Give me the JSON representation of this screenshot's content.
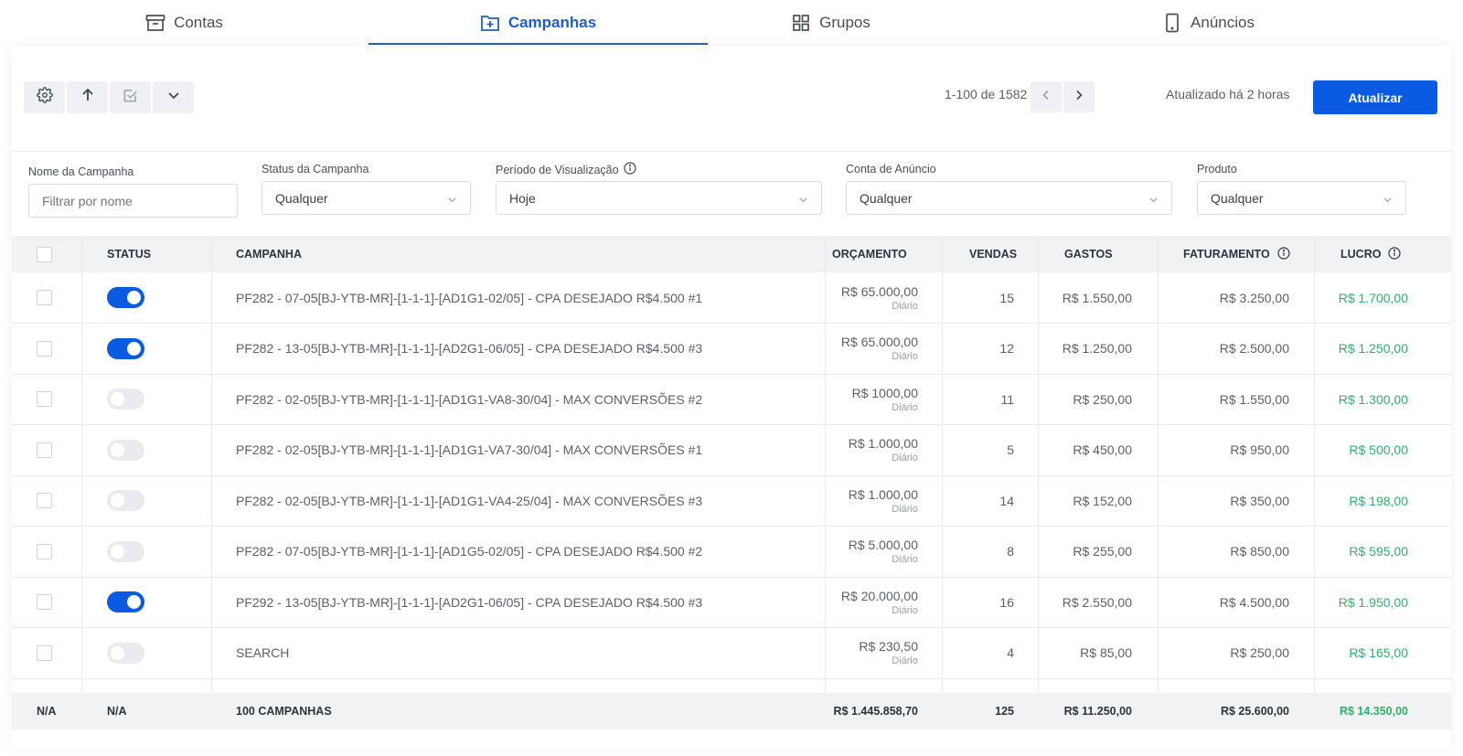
{
  "nav": {
    "tabs": [
      {
        "label": "Contas",
        "icon": "archive-icon"
      },
      {
        "label": "Campanhas",
        "icon": "folder-plus-icon",
        "active": true
      },
      {
        "label": "Grupos",
        "icon": "grid-icon"
      },
      {
        "label": "Anúncios",
        "icon": "smartphone-icon"
      }
    ]
  },
  "toolbar": {
    "pagination": "1-100 de 1582",
    "updated": "Atualizado há 2 horas",
    "refresh_label": "Atualizar"
  },
  "filters": {
    "name": {
      "label": "Nome da Campanha",
      "placeholder": "Filtrar por nome"
    },
    "status": {
      "label": "Status da Campanha",
      "value": "Qualquer"
    },
    "period": {
      "label": "Período de Visualização",
      "value": "Hoje"
    },
    "account": {
      "label": "Conta de Anúncio",
      "value": "Qualquer"
    },
    "product": {
      "label": "Produto",
      "value": "Qualquer"
    }
  },
  "table": {
    "headers": {
      "status": "STATUS",
      "campaign": "CAMPANHA",
      "budget": "ORÇAMENTO",
      "sales": "VENDAS",
      "spend": "GASTOS",
      "revenue": "FATURAMENTO",
      "profit": "LUCRO"
    },
    "rows": [
      {
        "active": true,
        "name": "PF282 - 07-05[BJ-YTB-MR]-[1-1-1]-[AD1G1-02/05] - CPA DESEJADO R$4.500 #1",
        "budget": "R$ 65.000,00",
        "period": "Diário",
        "sales": "15",
        "spend": "R$ 1.550,00",
        "revenue": "R$ 3.250,00",
        "profit": "R$ 1.700,00"
      },
      {
        "active": true,
        "name": "PF282 - 13-05[BJ-YTB-MR]-[1-1-1]-[AD2G1-06/05] - CPA DESEJADO R$4.500 #3",
        "budget": "R$ 65.000,00",
        "period": "Diário",
        "sales": "12",
        "spend": "R$ 1.250,00",
        "revenue": "R$ 2.500,00",
        "profit": "R$ 1.250,00"
      },
      {
        "active": false,
        "name": "PF282 - 02-05[BJ-YTB-MR]-[1-1-1]-[AD1G1-VA8-30/04] - MAX CONVERSÕES #2",
        "budget": "R$ 1000,00",
        "period": "Diário",
        "sales": "11",
        "spend": "R$ 250,00",
        "revenue": "R$ 1.550,00",
        "profit": "R$ 1.300,00"
      },
      {
        "active": false,
        "name": "PF282 - 02-05[BJ-YTB-MR]-[1-1-1]-[AD1G1-VA7-30/04] - MAX CONVERSÕES #1",
        "budget": "R$ 1.000,00",
        "period": "Diário",
        "sales": "5",
        "spend": "R$ 450,00",
        "revenue": "R$ 950,00",
        "profit": "R$ 500,00"
      },
      {
        "active": false,
        "name": "PF282 - 02-05[BJ-YTB-MR]-[1-1-1]-[AD1G1-VA4-25/04] - MAX CONVERSÕES #3",
        "budget": "R$ 1.000,00",
        "period": "Diário",
        "sales": "14",
        "spend": "R$ 152,00",
        "revenue": "R$ 350,00",
        "profit": "R$ 198,00"
      },
      {
        "active": false,
        "name": "PF282 - 07-05[BJ-YTB-MR]-[1-1-1]-[AD1G5-02/05] - CPA DESEJADO R$4.500 #2",
        "budget": "R$ 5.000,00",
        "period": "Diário",
        "sales": "8",
        "spend": "R$ 255,00",
        "revenue": "R$ 850,00",
        "profit": "R$ 595,00"
      },
      {
        "active": true,
        "name": "PF292 - 13-05[BJ-YTB-MR]-[1-1-1]-[AD2G1-06/05] - CPA DESEJADO R$4.500 #3",
        "budget": "R$ 20.000,00",
        "period": "Diário",
        "sales": "16",
        "spend": "R$ 2.550,00",
        "revenue": "R$ 4.500,00",
        "profit": "R$ 1.950,00"
      },
      {
        "active": false,
        "name": "SEARCH",
        "budget": "R$ 230,50",
        "period": "Diário",
        "sales": "4",
        "spend": "R$ 85,00",
        "revenue": "R$ 250,00",
        "profit": "R$ 165,00"
      }
    ],
    "footer": {
      "checkbox": "N/A",
      "status": "N/A",
      "campaign": "100 CAMPANHAS",
      "budget": "R$ 1.445.858,70",
      "sales": "125",
      "spend": "R$ 11.250,00",
      "revenue": "R$ 25.600,00",
      "profit": "R$ 14.350,00"
    }
  },
  "colors": {
    "accent": "#0a5be1",
    "profit": "#2cb36b",
    "header_bg": "#f1f2f4"
  }
}
